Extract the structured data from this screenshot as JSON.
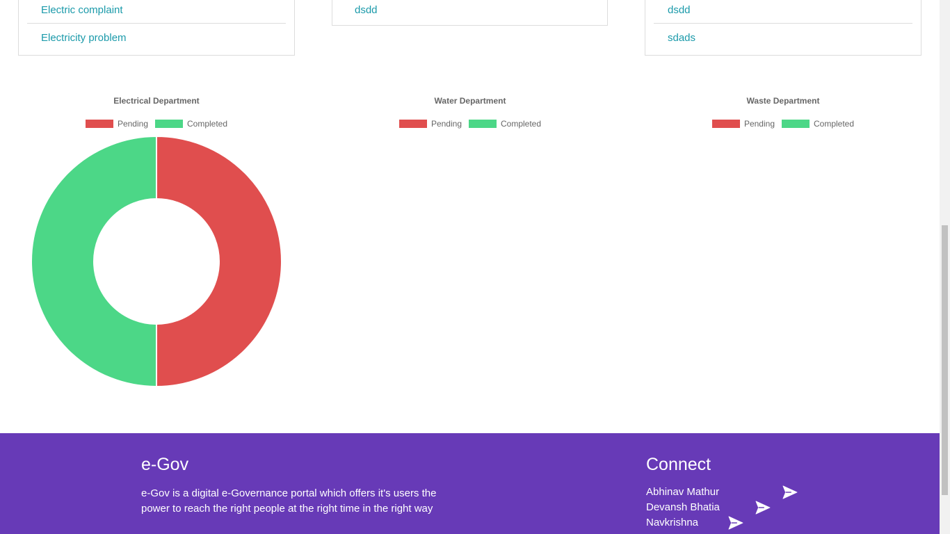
{
  "departments": {
    "electrical": {
      "complaints": [
        "Electric complaint",
        "Electricity problem"
      ]
    },
    "water": {
      "complaints": [
        "dsdd"
      ]
    },
    "waste": {
      "complaints": [
        "dsdd",
        "sdads"
      ]
    }
  },
  "legend": {
    "pending": "Pending",
    "completed": "Completed"
  },
  "colors": {
    "pending": "#e04e4e",
    "completed": "#4cd787",
    "footer_bg": "#673ab7",
    "link": "#1b9aaa"
  },
  "chart_data": [
    {
      "type": "pie",
      "title": "Electrical Department",
      "categories": [
        "Pending",
        "Completed"
      ],
      "values": [
        1,
        1
      ],
      "legend": "top"
    },
    {
      "type": "pie",
      "title": "Water Department",
      "categories": [
        "Pending",
        "Completed"
      ],
      "values": [
        0,
        0
      ],
      "legend": "top"
    },
    {
      "type": "pie",
      "title": "Waste Department",
      "categories": [
        "Pending",
        "Completed"
      ],
      "values": [
        0,
        0
      ],
      "legend": "top"
    }
  ],
  "footer": {
    "brand_title": "e-Gov",
    "brand_description": "e-Gov is a digital e-Governance portal which offers it's users the power to reach the right people at the right time in the right way",
    "connect_title": "Connect",
    "contacts": [
      {
        "name": "Abhinav Mathur",
        "icon": "send-icon"
      },
      {
        "name": "Devansh Bhatia",
        "icon": "send-icon"
      },
      {
        "name": "Navkrishna",
        "icon": "send-icon"
      }
    ]
  }
}
